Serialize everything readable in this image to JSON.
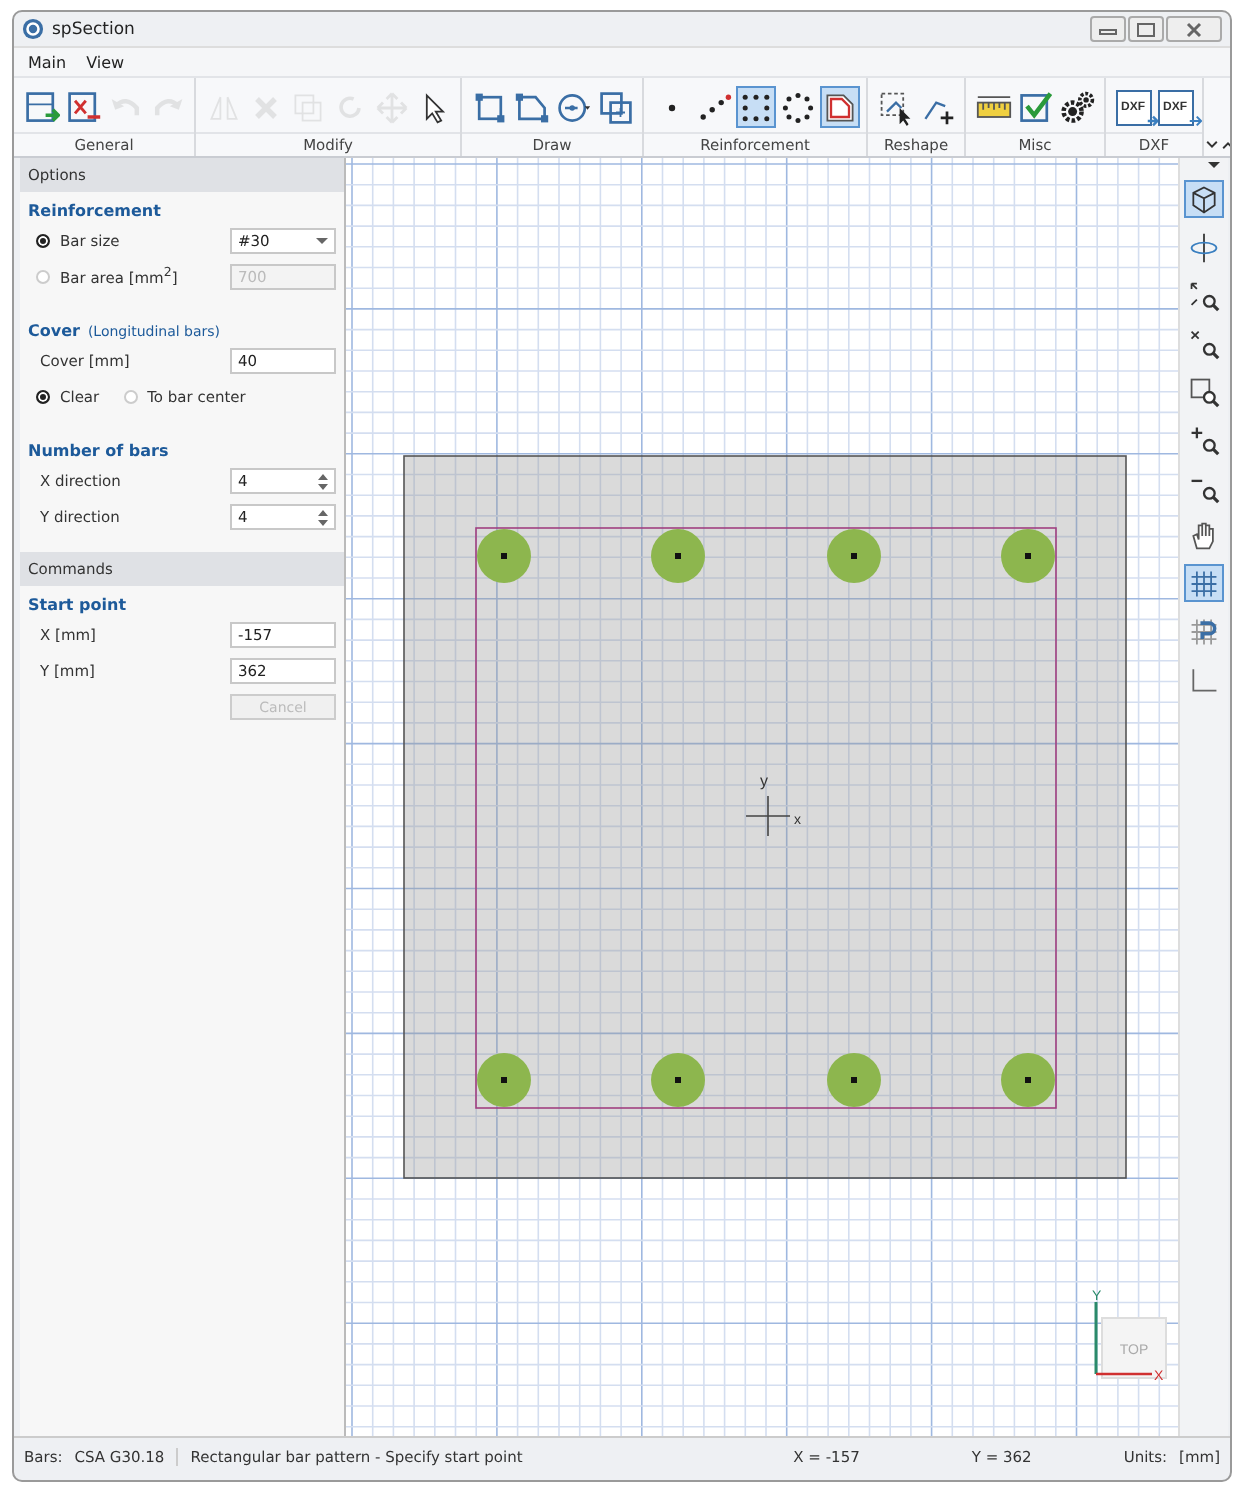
{
  "window": {
    "title": "spSection"
  },
  "menu": [
    "Main",
    "View"
  ],
  "ribbon": [
    {
      "label": "General",
      "buttons": [
        {
          "kind": "save",
          "disabled": false,
          "selected": false
        },
        {
          "kind": "close",
          "disabled": false,
          "selected": false
        },
        {
          "kind": "undo",
          "disabled": true,
          "selected": false
        },
        {
          "kind": "redo",
          "disabled": true,
          "selected": false
        }
      ]
    },
    {
      "label": "Modify",
      "buttons": [
        {
          "kind": "mirror",
          "disabled": true,
          "selected": false
        },
        {
          "kind": "delete",
          "disabled": true,
          "selected": false
        },
        {
          "kind": "copy",
          "disabled": true,
          "selected": false
        },
        {
          "kind": "rotate",
          "disabled": true,
          "selected": false
        },
        {
          "kind": "move",
          "disabled": true,
          "selected": false
        },
        {
          "kind": "pointer",
          "disabled": false,
          "selected": false
        }
      ]
    },
    {
      "label": "Draw",
      "buttons": [
        {
          "kind": "rectangle",
          "disabled": false,
          "selected": false
        },
        {
          "kind": "polygon",
          "disabled": false,
          "selected": false
        },
        {
          "kind": "circle",
          "disabled": false,
          "selected": false
        },
        {
          "kind": "combine",
          "disabled": false,
          "selected": false
        }
      ]
    },
    {
      "label": "Reinforcement",
      "buttons": [
        {
          "kind": "single-bar",
          "disabled": false,
          "selected": false
        },
        {
          "kind": "line-bars",
          "disabled": false,
          "selected": false
        },
        {
          "kind": "rect-pattern",
          "disabled": false,
          "selected": true
        },
        {
          "kind": "circle-pattern",
          "disabled": false,
          "selected": false
        },
        {
          "kind": "cover-pattern",
          "disabled": false,
          "selected": true
        }
      ]
    },
    {
      "label": "Reshape",
      "buttons": [
        {
          "kind": "reshape-select",
          "disabled": false,
          "selected": false
        },
        {
          "kind": "reshape-add",
          "disabled": false,
          "selected": false
        }
      ]
    },
    {
      "label": "Misc",
      "buttons": [
        {
          "kind": "ruler",
          "disabled": false,
          "selected": false
        },
        {
          "kind": "check",
          "disabled": false,
          "selected": false
        },
        {
          "kind": "gears",
          "disabled": false,
          "selected": false
        }
      ]
    },
    {
      "label": "DXF",
      "buttons": [
        {
          "kind": "dxf-import",
          "text": "DXF",
          "disabled": false,
          "selected": false
        },
        {
          "kind": "dxf-export",
          "text": "DXF",
          "disabled": false,
          "selected": false
        }
      ]
    }
  ],
  "options": {
    "header": "Options",
    "reinforcement": {
      "title": "Reinforcement",
      "choices": [
        {
          "label": "Bar size",
          "selected": true,
          "value": "#30",
          "disabled": false
        },
        {
          "label": "Bar area [mm$^{2}$]",
          "selected": false,
          "value": "700",
          "disabled": true
        }
      ]
    },
    "cover": {
      "title": "Cover",
      "note": "(Longitudinal bars)",
      "label": "Cover [mm]",
      "value": "40",
      "radios": [
        {
          "label": "Clear",
          "selected": true
        },
        {
          "label": "To bar center",
          "selected": false
        }
      ]
    },
    "number_of_bars": {
      "title": "Number of bars",
      "fields": [
        {
          "label": "X direction",
          "value": "4"
        },
        {
          "label": "Y direction",
          "value": "4"
        }
      ]
    }
  },
  "commands": {
    "header": "Commands",
    "title": "Start point",
    "fields": [
      {
        "label": "X [mm]",
        "value": "-157"
      },
      {
        "label": "Y [mm]",
        "value": "362"
      }
    ],
    "cancel": {
      "label": "Cancel",
      "disabled": true
    }
  },
  "canvas": {
    "axis_labels": {
      "y": "y",
      "x": "x"
    },
    "view_cube": {
      "face": "TOP",
      "x": "X",
      "y": "Y"
    }
  },
  "right_toolbar": [
    {
      "kind": "view3d",
      "selected": true
    },
    {
      "kind": "orbit",
      "selected": false
    },
    {
      "kind": "zoom-extents",
      "selected": false
    },
    {
      "kind": "zoom-fit",
      "selected": false
    },
    {
      "kind": "zoom-window",
      "selected": false
    },
    {
      "kind": "zoom-in",
      "selected": false
    },
    {
      "kind": "zoom-out",
      "selected": false
    },
    {
      "kind": "pan",
      "selected": false
    },
    {
      "kind": "grid",
      "selected": true
    },
    {
      "kind": "snap",
      "selected": false
    },
    {
      "kind": "axes",
      "selected": false
    }
  ],
  "status_bar": {
    "bars_label": "Bars:",
    "bars_value": "CSA G30.18",
    "message": "Rectangular bar pattern - Specify start point",
    "x": "X = -157",
    "y": "Y = 362",
    "units_label": "Units:",
    "units": "[mm]"
  }
}
